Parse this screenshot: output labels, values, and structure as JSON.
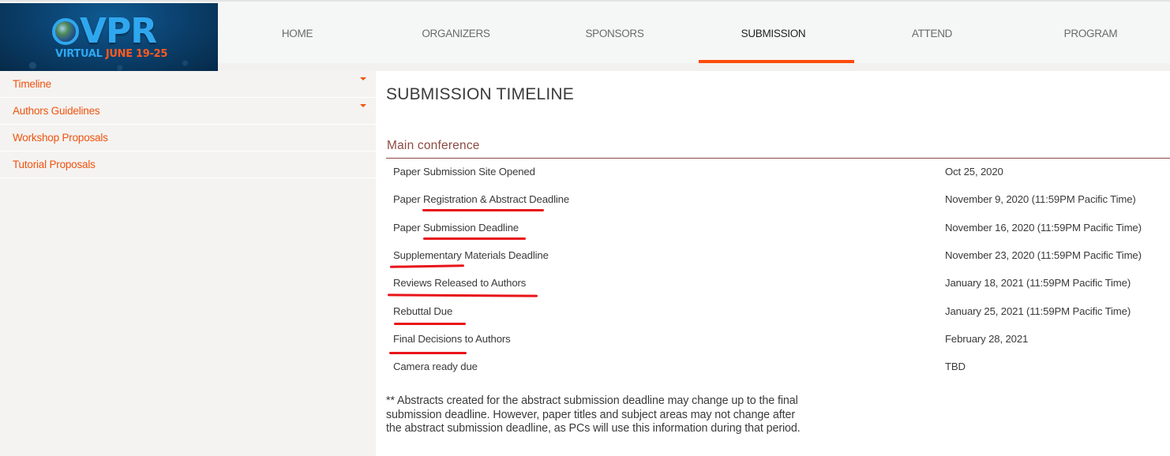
{
  "logo": {
    "main": "VPR",
    "sub_virtual": "VIRTUAL",
    "sub_dates": "JUNE 19-25",
    "colors": {
      "blue": "#2fa7ef",
      "orange": "#ff5a1f"
    }
  },
  "nav": {
    "items": [
      {
        "label": "HOME",
        "active": false
      },
      {
        "label": "ORGANIZERS",
        "active": false
      },
      {
        "label": "SPONSORS",
        "active": false
      },
      {
        "label": "SUBMISSION",
        "active": true
      },
      {
        "label": "ATTEND",
        "active": false
      },
      {
        "label": "PROGRAM",
        "active": false
      }
    ],
    "active_color": "#ff4b0a"
  },
  "sidebar": {
    "items": [
      {
        "label": "Timeline",
        "has_dropdown": true
      },
      {
        "label": "Authors Guidelines",
        "has_dropdown": true
      },
      {
        "label": "Workshop Proposals",
        "has_dropdown": false
      },
      {
        "label": "Tutorial Proposals",
        "has_dropdown": false
      }
    ],
    "link_color": "#f0520f"
  },
  "main": {
    "page_title": "SUBMISSION TIMELINE",
    "section_title": "Main conference",
    "timeline": [
      {
        "event": "Paper Submission Site Opened",
        "date": "Oct 25, 2020"
      },
      {
        "event": "Paper Registration & Abstract Deadline",
        "date": "November 9, 2020 (11:59PM Pacific Time)"
      },
      {
        "event": "Paper Submission Deadline",
        "date": "November 16, 2020 (11:59PM Pacific Time)"
      },
      {
        "event": "Supplementary Materials Deadline",
        "date": "November 23, 2020 (11:59PM Pacific Time)"
      },
      {
        "event": "Reviews Released to Authors",
        "date": "January 18, 2021 (11:59PM Pacific Time)"
      },
      {
        "event": "Rebuttal Due",
        "date": "January 25, 2021 (11:59PM Pacific Time)"
      },
      {
        "event": "Final Decisions to Authors",
        "date": "February 28, 2021"
      },
      {
        "event": "Camera ready due",
        "date": "TBD"
      }
    ],
    "note": "** Abstracts created for the abstract submission deadline may change up to the final submission deadline.  However, paper titles and subject areas may not change after the abstract submission deadline, as PCs will use this information during that period."
  },
  "annotations": {
    "underline_color": "#e8141a"
  }
}
